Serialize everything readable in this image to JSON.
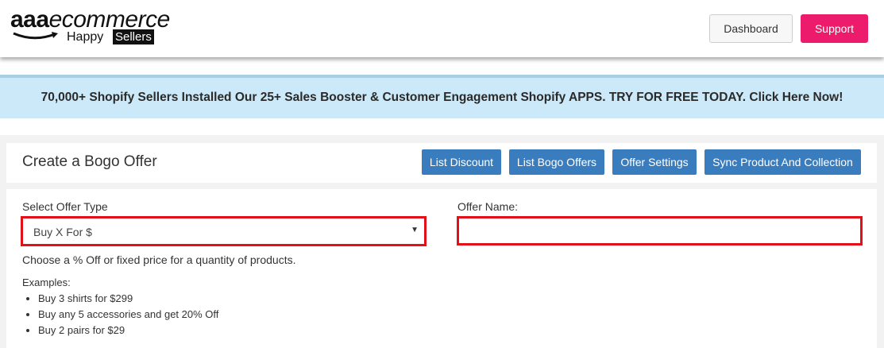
{
  "logo": {
    "word_bold": "aaa",
    "word_italic": "ecommerce",
    "happy": "Happy",
    "sellers": "Sellers"
  },
  "header": {
    "dashboard_label": "Dashboard",
    "support_label": "Support"
  },
  "banner": {
    "text": "70,000+ Shopify Sellers Installed Our 25+ Sales Booster & Customer Engagement Shopify APPS. TRY FOR FREE TODAY. Click Here Now!"
  },
  "page": {
    "title": "Create a Bogo Offer",
    "nav_buttons": [
      "List Discount",
      "List Bogo Offers",
      "Offer Settings",
      "Sync Product And Collection"
    ]
  },
  "form": {
    "offer_type_label": "Select Offer Type",
    "offer_type_value": "Buy X For $",
    "offer_name_label": "Offer Name:",
    "offer_name_value": "",
    "help_text": "Choose a % Off or fixed price for a quantity of products.",
    "examples_title": "Examples:",
    "examples": [
      "Buy 3 shirts for $299",
      "Buy any 5 accessories and get 20% Off",
      "Buy 2 pairs for $29"
    ]
  },
  "colors": {
    "support": "#ec1b6c",
    "nav_button": "#3a7dbf",
    "banner": "#cbe9f8",
    "highlight_border": "#e3101a"
  }
}
